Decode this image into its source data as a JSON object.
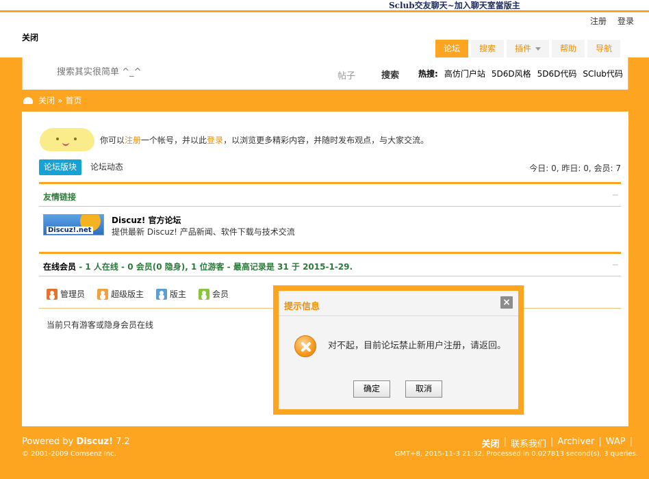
{
  "header": {
    "site_banner": "Sclub交友聊天~加入聊天室當版主",
    "register": "注册",
    "login": "登录",
    "logo_text": "关闭"
  },
  "nav": {
    "tabs": [
      {
        "label": "论坛",
        "active": true
      },
      {
        "label": "搜索"
      },
      {
        "label": "插件"
      },
      {
        "label": "帮助"
      },
      {
        "label": "导航"
      }
    ]
  },
  "search": {
    "placeholder": "搜索其实很简单 ^_^",
    "type": "帖子",
    "button": "搜索",
    "hot_label": "热搜:",
    "hot_items": [
      "高仿门户站",
      "5D6D风格",
      "5D6D代码",
      "SClub代码"
    ]
  },
  "breadcrumb": {
    "items": [
      "关闭",
      "»",
      "首页"
    ]
  },
  "welcome": {
    "prefix": "你可以",
    "register_link": "注册",
    "middle": "一个帐号，并以此",
    "login_link": "登录",
    "suffix": "，以浏览更多精彩内容，并随时发布观点，与大家交流。"
  },
  "tabs": {
    "forum": "论坛版块",
    "activity": "论坛动态",
    "stats": "今日: 0, 昨日: 0, 会员: 7"
  },
  "friends": {
    "title": "友情链接",
    "logo_text": "Discuz!.net",
    "name": "Discuz! 官方论坛",
    "desc": "提供最新 Discuz! 产品新闻、软件下载与技术交流"
  },
  "online": {
    "caption": "在线会员",
    "line": " - 1 人在线 - 0 会员(0 隐身), 1 位游客 - 最高记录是 31 于 2015-1-29.",
    "legend": [
      {
        "label": "管理员",
        "color": "#e8702a"
      },
      {
        "label": "超级版主",
        "color": "#f0a040"
      },
      {
        "label": "版主",
        "color": "#5a9ed6"
      },
      {
        "label": "会员",
        "color": "#8ac43a"
      }
    ],
    "empty": "当前只有游客或隐身会员在线"
  },
  "footer": {
    "powered_prefix": "Powered by ",
    "powered_brand": "Discuz!",
    "powered_version": " 7.2",
    "copyright": "© 2001-2009 Comsenz Inc.",
    "links": [
      "关闭",
      "联系我们",
      "Archiver",
      "WAP"
    ],
    "gmt": "GMT+8, 2015-11-3 21:32, Processed in 0.027813 second(s), 3 queries."
  },
  "modal": {
    "title": "提示信息",
    "close": "×",
    "message": "对不起，目前论坛禁止新用户注册，请返回。",
    "confirm": "确定",
    "cancel": "取消"
  },
  "colors": {
    "accent": "#fda521",
    "link": "#f08e00",
    "tab_active": "#17a2d6",
    "section_title": "#2b7a3a"
  }
}
